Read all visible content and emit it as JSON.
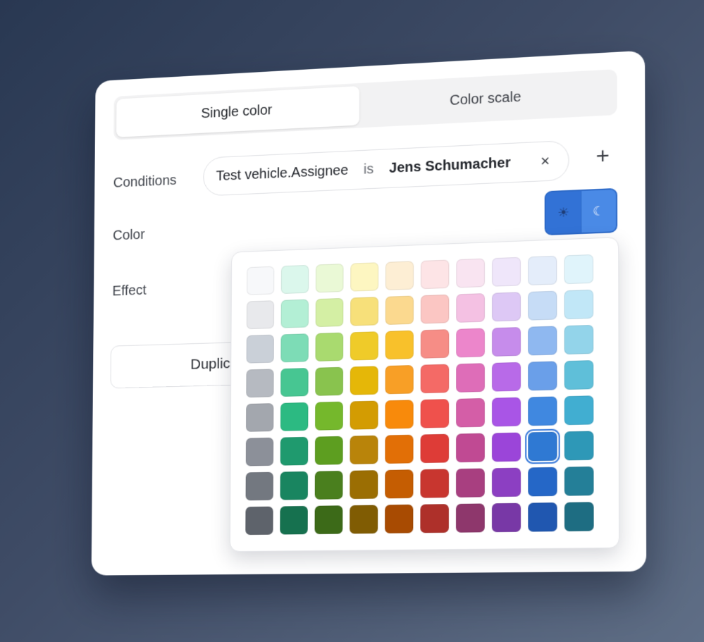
{
  "tabs": [
    {
      "label": "Single color",
      "active": true
    },
    {
      "label": "Color scale",
      "active": false
    }
  ],
  "labels": {
    "conditions": "Conditions",
    "color": "Color",
    "effect": "Effect"
  },
  "condition": {
    "field": "Test vehicle.Assignee",
    "operator": "is",
    "value": "Jens Schumacher",
    "remove_icon": "×",
    "add_icon": "+"
  },
  "theme_toggle": {
    "light_icon": "☀",
    "dark_icon": "☾",
    "accent": "#3a7bdb"
  },
  "duplicate_label": "Duplic",
  "palette": {
    "selected": {
      "row": 5,
      "col": 8
    },
    "rows": [
      [
        "#f7f8fa",
        "#dbf7ec",
        "#eaf9d6",
        "#fdf6c1",
        "#fdeed4",
        "#fde4e6",
        "#f9e4f1",
        "#efe6fa",
        "#e4edfa",
        "#e0f4fb"
      ],
      [
        "#e8e9ec",
        "#b3efd5",
        "#d4efa4",
        "#f7e07a",
        "#fbd98f",
        "#fbc6c3",
        "#f4c1e3",
        "#ddc8f5",
        "#c6dcf6",
        "#c1e7f7"
      ],
      [
        "#cad0d8",
        "#7ddcb6",
        "#a9da6f",
        "#efcb29",
        "#f8c12b",
        "#f68d86",
        "#ec86cb",
        "#c68ceb",
        "#8fb8f0",
        "#93d4ea"
      ],
      [
        "#b6bac1",
        "#47c692",
        "#89c34e",
        "#e5b708",
        "#f89f26",
        "#f46a66",
        "#de6db8",
        "#b86ae8",
        "#6a9fe9",
        "#5fbfd9"
      ],
      [
        "#a3a7ae",
        "#2cba82",
        "#75b82c",
        "#d39c02",
        "#f88a0b",
        "#ef514c",
        "#d45ea7",
        "#a955e6",
        "#4088e0",
        "#41aed1"
      ],
      [
        "#8c9099",
        "#1f9a6e",
        "#5d9e20",
        "#b9840a",
        "#e26f06",
        "#de3c37",
        "#c04a93",
        "#9b45d9",
        "#2f79d3",
        "#2e98b7"
      ],
      [
        "#737880",
        "#198560",
        "#4a7f1e",
        "#9b6e03",
        "#c55d02",
        "#c8362f",
        "#a83f80",
        "#8c3fc2",
        "#2567c7",
        "#247f98"
      ],
      [
        "#5e636b",
        "#16714f",
        "#3c6a18",
        "#805c03",
        "#a84b02",
        "#ae302a",
        "#8e376c",
        "#7838a6",
        "#2057b0",
        "#1e6d82"
      ]
    ]
  }
}
